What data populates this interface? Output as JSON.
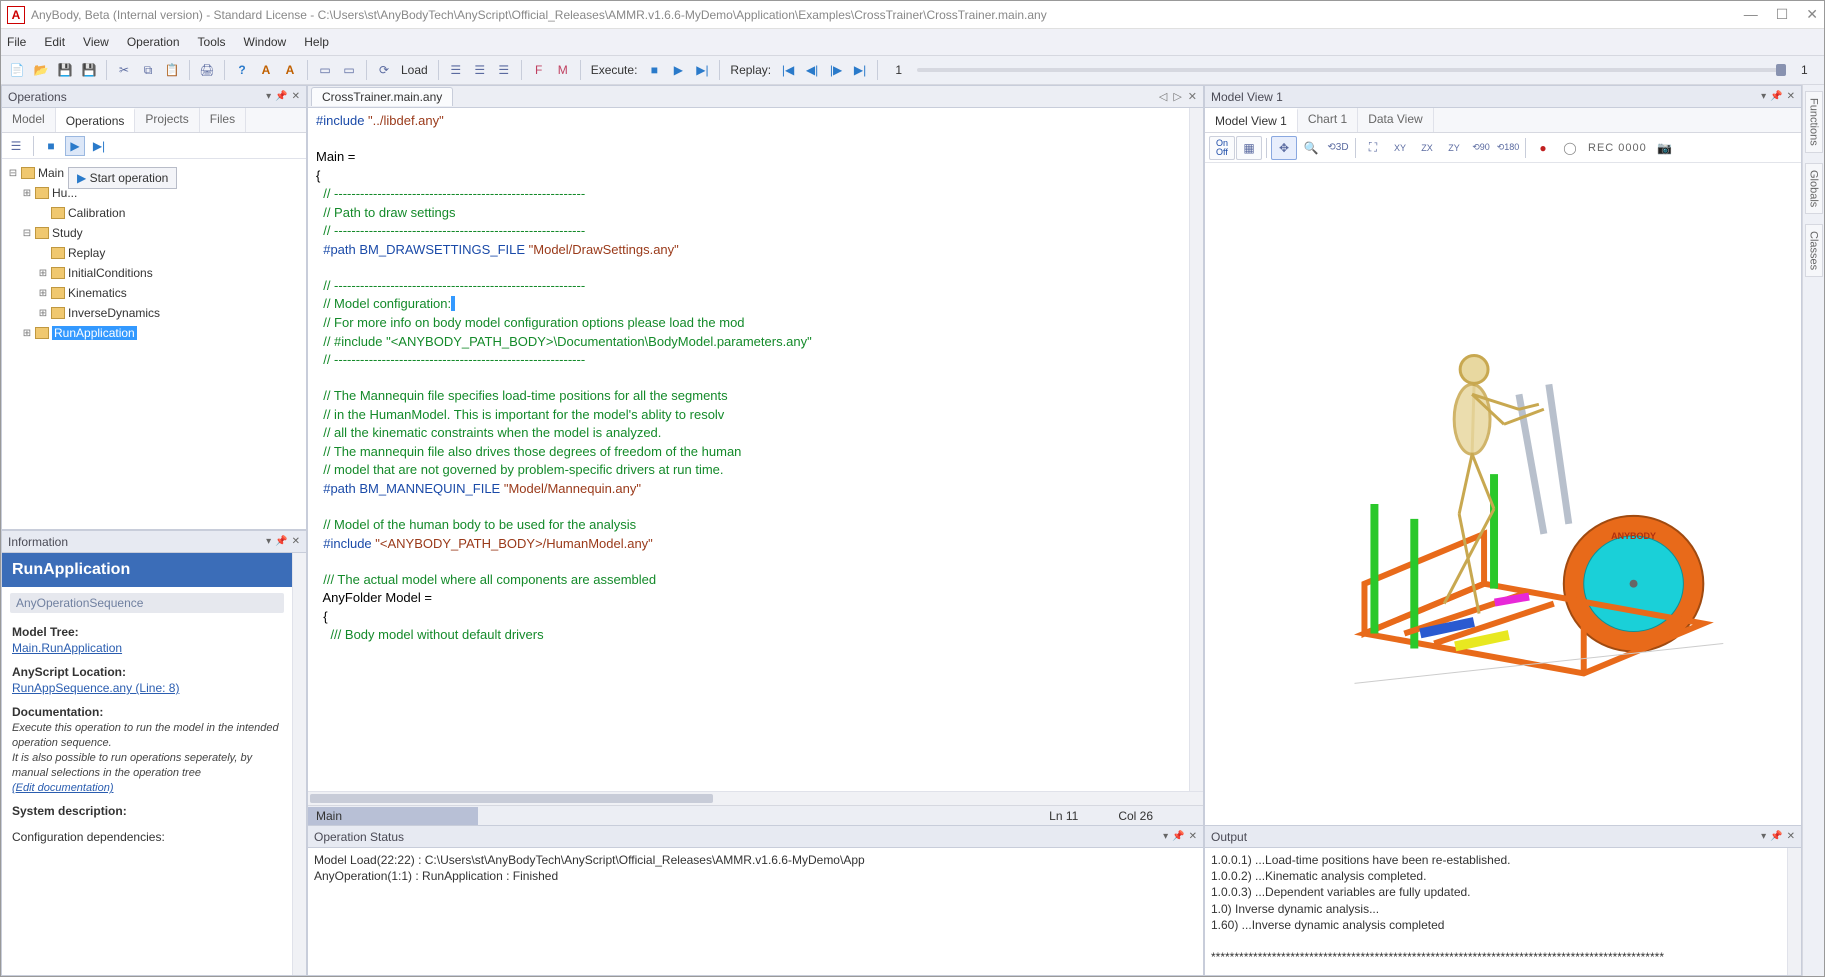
{
  "titlebar": {
    "text": "AnyBody, Beta (Internal version)  -  Standard License  -  C:\\Users\\st\\AnyBodyTech\\AnyScript\\Official_Releases\\AMMR.v1.6.6-MyDemo\\Application\\Examples\\CrossTrainer\\CrossTrainer.main.any"
  },
  "menu": {
    "items": [
      "File",
      "Edit",
      "View",
      "Operation",
      "Tools",
      "Window",
      "Help"
    ]
  },
  "toolbar": {
    "load_label": "Load",
    "execute_label": "Execute:",
    "replay_label": "Replay:",
    "frame_left": "1",
    "frame_right": "1"
  },
  "operations": {
    "title": "Operations",
    "tabs": [
      "Model",
      "Operations",
      "Projects",
      "Files"
    ],
    "active_tab": 1,
    "tooltip": "Start operation",
    "tree": [
      {
        "level": 0,
        "exp": "−",
        "label": "Main"
      },
      {
        "level": 1,
        "exp": "+",
        "label": "HumanModel",
        "truncated": true
      },
      {
        "level": 2,
        "exp": "",
        "label": "Calibration"
      },
      {
        "level": 1,
        "exp": "−",
        "label": "Study"
      },
      {
        "level": 2,
        "exp": "",
        "label": "Replay"
      },
      {
        "level": 2,
        "exp": "+",
        "label": "InitialConditions"
      },
      {
        "level": 2,
        "exp": "+",
        "label": "Kinematics"
      },
      {
        "level": 2,
        "exp": "+",
        "label": "InverseDynamics"
      },
      {
        "level": 1,
        "exp": "+",
        "label": "RunApplication",
        "selected": true
      }
    ]
  },
  "information": {
    "title": "Information",
    "heading": "RunApplication",
    "type": "AnyOperationSequence",
    "model_tree_label": "Model Tree:",
    "model_tree_link": "Main.RunApplication",
    "script_loc_label": "AnyScript Location:",
    "script_loc_link": "RunAppSequence.any (Line: 8)",
    "doc_label": "Documentation:",
    "doc1": "Execute this operation to run the model in the intended operation sequence.",
    "doc2": "It is also possible to run operations seperately, by manual selections in the operation tree",
    "edit_doc": "(Edit documentation)",
    "sys_desc": "System description:",
    "config_deps": "Configuration dependencies:"
  },
  "editor": {
    "tab": "CrossTrainer.main.any",
    "status_file": "Main",
    "status_ln": "Ln 11",
    "status_col": "Col 26",
    "code_lines": [
      {
        "t": "dir",
        "text": "#include "
      },
      {
        "t": "str",
        "text": "\"../libdef.any\""
      },
      {
        "t": "nl"
      },
      {
        "t": "nl"
      },
      {
        "t": "plain",
        "text": "Main ="
      },
      {
        "t": "nl"
      },
      {
        "t": "plain",
        "text": "{"
      },
      {
        "t": "nl"
      },
      {
        "t": "cmt",
        "text": "  // ----------------------------------------------------------"
      },
      {
        "t": "nl"
      },
      {
        "t": "cmt",
        "text": "  // Path to draw settings"
      },
      {
        "t": "nl"
      },
      {
        "t": "cmt",
        "text": "  // ----------------------------------------------------------"
      },
      {
        "t": "nl"
      },
      {
        "t": "dir",
        "text": "  #path BM_DRAWSETTINGS_FILE "
      },
      {
        "t": "str",
        "text": "\"Model/DrawSettings.any\""
      },
      {
        "t": "nl"
      },
      {
        "t": "nl"
      },
      {
        "t": "cmt",
        "text": "  // ----------------------------------------------------------"
      },
      {
        "t": "nl"
      },
      {
        "t": "cmt",
        "text": "  // Model configuration:"
      },
      {
        "t": "cursor",
        "text": " "
      },
      {
        "t": "nl"
      },
      {
        "t": "cmt",
        "text": "  // For more info on body model configuration options please load the mod"
      },
      {
        "t": "nl"
      },
      {
        "t": "cmt",
        "text": "  // #include \"<ANYBODY_PATH_BODY>\\Documentation\\BodyModel.parameters.any\""
      },
      {
        "t": "nl"
      },
      {
        "t": "cmt",
        "text": "  // ----------------------------------------------------------"
      },
      {
        "t": "nl"
      },
      {
        "t": "nl"
      },
      {
        "t": "cmt",
        "text": "  // The Mannequin file specifies load-time positions for all the segments"
      },
      {
        "t": "nl"
      },
      {
        "t": "cmt",
        "text": "  // in the HumanModel. This is important for the model's ablity to resolv"
      },
      {
        "t": "nl"
      },
      {
        "t": "cmt",
        "text": "  // all the kinematic constraints when the model is analyzed."
      },
      {
        "t": "nl"
      },
      {
        "t": "cmt",
        "text": "  // The mannequin file also drives those degrees of freedom of the human"
      },
      {
        "t": "nl"
      },
      {
        "t": "cmt",
        "text": "  // model that are not governed by problem-specific drivers at run time."
      },
      {
        "t": "nl"
      },
      {
        "t": "dir",
        "text": "  #path BM_MANNEQUIN_FILE "
      },
      {
        "t": "str",
        "text": "\"Model/Mannequin.any\""
      },
      {
        "t": "nl"
      },
      {
        "t": "nl"
      },
      {
        "t": "cmt",
        "text": "  // Model of the human body to be used for the analysis"
      },
      {
        "t": "nl"
      },
      {
        "t": "dir",
        "text": "  #include "
      },
      {
        "t": "str",
        "text": "\"<ANYBODY_PATH_BODY>/HumanModel.any\""
      },
      {
        "t": "nl"
      },
      {
        "t": "nl"
      },
      {
        "t": "cmt",
        "text": "  /// The actual model where all components are assembled"
      },
      {
        "t": "nl"
      },
      {
        "t": "plain",
        "text": "  AnyFolder Model ="
      },
      {
        "t": "nl"
      },
      {
        "t": "plain",
        "text": "  {"
      },
      {
        "t": "nl"
      },
      {
        "t": "cmt",
        "text": "    /// Body model without default drivers"
      },
      {
        "t": "nl"
      }
    ]
  },
  "opstatus": {
    "title": "Operation Status",
    "lines": [
      "Model Load(22:22) : C:\\Users\\st\\AnyBodyTech\\AnyScript\\Official_Releases\\AMMR.v1.6.6-MyDemo\\App",
      "AnyOperation(1:1) : RunApplication : Finished"
    ]
  },
  "modelview": {
    "title": "Model View 1",
    "tabs": [
      "Model View 1",
      "Chart 1",
      "Data View"
    ],
    "rec_label": "REC  0000",
    "logo_text": "ANYBODY"
  },
  "output": {
    "title": "Output",
    "lines": [
      "1.0.0.1) ...Load-time positions have been re-established.",
      "1.0.0.2) ...Kinematic analysis completed.",
      "1.0.0.3) ...Dependent variables are fully updated.",
      "1.0) Inverse dynamic analysis...",
      "1.60) ...Inverse dynamic analysis completed",
      "",
      "*************************************************************************************************"
    ]
  },
  "sidetabs": [
    "Functions",
    "Globals",
    "Classes"
  ]
}
